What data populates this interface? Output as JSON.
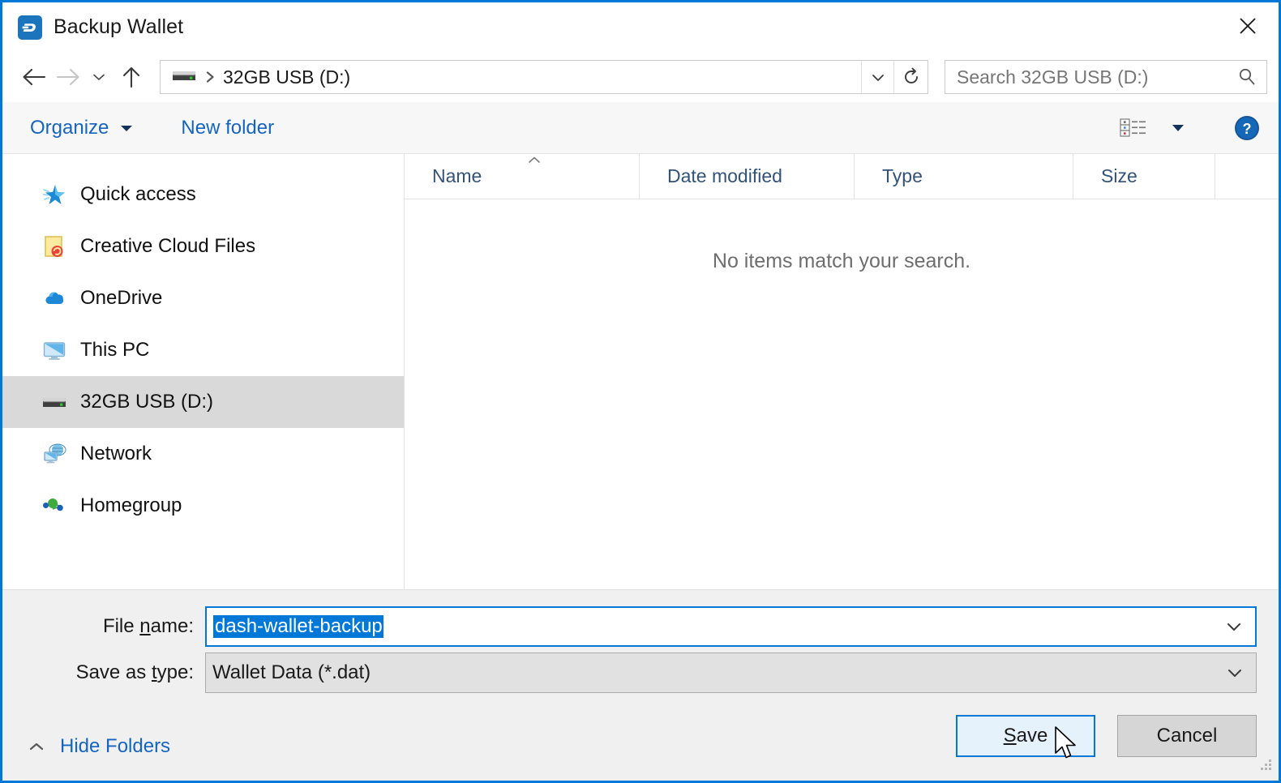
{
  "window": {
    "title": "Backup Wallet",
    "app_icon": "dash-logo-icon",
    "close_icon": "close-icon",
    "accent_color": "#0078d7"
  },
  "nav": {
    "back_icon": "arrow-left-icon",
    "forward_icon": "arrow-right-icon",
    "history_icon": "chevron-down-icon",
    "up_icon": "arrow-up-icon",
    "address": {
      "drive_icon": "usb-drive-icon",
      "separator_icon": "chevron-right-icon",
      "path": "32GB USB (D:)",
      "dropdown_icon": "chevron-down-icon",
      "refresh_icon": "refresh-icon"
    },
    "search": {
      "placeholder": "Search 32GB USB (D:)",
      "icon": "search-icon"
    }
  },
  "toolbar": {
    "organize_label": "Organize",
    "organize_caret": "caret-down-icon",
    "new_folder_label": "New folder",
    "view_icon": "change-view-icon",
    "view_caret": "caret-down-icon",
    "help_icon": "help-icon"
  },
  "sidebar": {
    "items": [
      {
        "label": "Quick access",
        "icon": "star-icon",
        "selected": false
      },
      {
        "label": "Creative Cloud Files",
        "icon": "creative-cloud-icon",
        "selected": false
      },
      {
        "label": "OneDrive",
        "icon": "cloud-icon",
        "selected": false
      },
      {
        "label": "This PC",
        "icon": "monitor-icon",
        "selected": false
      },
      {
        "label": "32GB USB (D:)",
        "icon": "usb-drive-icon",
        "selected": true
      },
      {
        "label": "Network",
        "icon": "network-icon",
        "selected": false
      },
      {
        "label": "Homegroup",
        "icon": "homegroup-icon",
        "selected": false
      }
    ]
  },
  "file_list": {
    "columns": [
      "Name",
      "Date modified",
      "Type",
      "Size"
    ],
    "sort_column": "Name",
    "sort_direction": "ascending",
    "sort_icon": "caret-up-icon",
    "rows": [],
    "empty_message": "No items match your search."
  },
  "form": {
    "filename_label_pre": "File ",
    "filename_label_accel": "n",
    "filename_label_post": "ame:",
    "filename_value": "dash-wallet-backup",
    "filename_selected": true,
    "filename_chevron": "chevron-down-icon",
    "filetype_label_pre": "Save as ",
    "filetype_label_accel": "t",
    "filetype_label_post": "ype:",
    "filetype_value": "Wallet Data (*.dat)",
    "filetype_chevron": "chevron-down-icon"
  },
  "footer": {
    "hide_folders_label": "Hide Folders",
    "hide_folders_icon": "caret-up-icon",
    "save_pre": "",
    "save_accel": "S",
    "save_post": "ave",
    "save_hovered": true,
    "cancel_label": "Cancel",
    "resize_grip_icon": "resize-grip-icon",
    "cursor_icon": "mouse-pointer-icon"
  }
}
